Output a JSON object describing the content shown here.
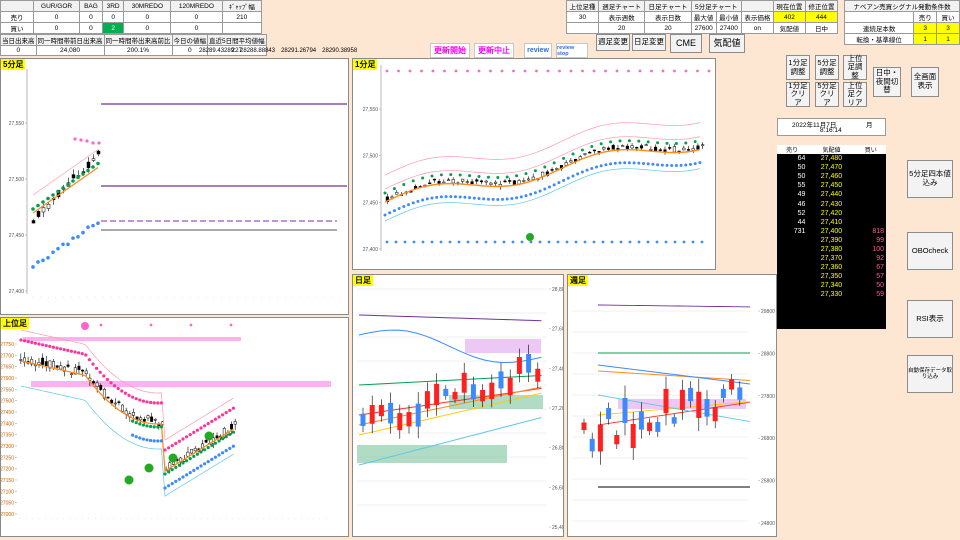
{
  "summary_table": {
    "headers": [
      "",
      "GUR/GOR",
      "BAG",
      "3RD",
      "30MREDO",
      "120MREDO",
      "ｷﾞｬｯﾌﾟ幅"
    ],
    "rows": [
      [
        "売り",
        "0",
        "0",
        "0",
        "0",
        "0",
        "210"
      ],
      [
        "買い",
        "0",
        "0",
        "2",
        "0",
        "0",
        ""
      ]
    ]
  },
  "stats": {
    "labels": [
      "当日出来高",
      "同一時間帯前日出来高",
      "同一時間帯出来高前比",
      "今日の値幅",
      "直近5日間平均値幅"
    ],
    "values": [
      "0",
      "24,080",
      "200.1%",
      "0",
      "227"
    ],
    "numbers": [
      "28289.43289",
      "28288.88843",
      "28291.26794",
      "28290.38958"
    ]
  },
  "toolbar": {
    "update_start": "更新開始",
    "update_stop": "更新中止",
    "review": "review",
    "review_stop": "review stop"
  },
  "chart_settings": {
    "headers": [
      "上位足種",
      "週足チャート",
      "日足チャート",
      "5分足チャート",
      "",
      "",
      "現在位置",
      "修正位置"
    ],
    "row2": [
      "30",
      "表示週数",
      "表示日数",
      "最大値",
      "最小値",
      "表示価格",
      "402",
      "444"
    ],
    "row3": [
      "",
      "20",
      "20",
      "27600",
      "27400",
      "on",
      "気配値",
      "日中"
    ],
    "btn_week": "週足変更",
    "btn_day": "日足変更",
    "btn_cme": "CME",
    "btn_quote": "気配値"
  },
  "signal_panel": {
    "title": "ナベアン売買シグナル発動条件数",
    "sell_label": "売り",
    "buy_label": "買い",
    "row1_label": "連続足本数",
    "row1_values": [
      "3",
      "3"
    ],
    "row2_label": "転換・基準線位",
    "row2_values": [
      "1",
      "1"
    ]
  },
  "right_buttons": {
    "b1m_adjust": "1分足調整",
    "b5m_adjust": "5分足調整",
    "bup_adjust": "上位足調整",
    "b1m_clear": "1分足クリア",
    "b5m_clear": "5分足クリア",
    "bup_clear": "上位足クリア",
    "session_switch": "日中・夜間切替",
    "full_screen": "全画面表示",
    "load_5m": "5分足四本値込み",
    "obo_check": "OBOcheck",
    "rsi_show": "RSI表示",
    "auto_save": "自動保存データ取り込み"
  },
  "datetime": {
    "date": "2022年11月7日",
    "weekday": "月",
    "time": "8:16:14"
  },
  "board": {
    "headers": [
      "売り",
      "気配値",
      "買い"
    ],
    "rows": [
      [
        "64",
        "27,480",
        ""
      ],
      [
        "50",
        "27,470",
        ""
      ],
      [
        "50",
        "27,460",
        ""
      ],
      [
        "55",
        "27,450",
        ""
      ],
      [
        "49",
        "27,440",
        ""
      ],
      [
        "46",
        "27,430",
        ""
      ],
      [
        "52",
        "27,420",
        ""
      ],
      [
        "44",
        "27,410",
        ""
      ],
      [
        "731",
        "27,400",
        "818"
      ],
      [
        "",
        "27,390",
        "99"
      ],
      [
        "",
        "27,380",
        "100"
      ],
      [
        "",
        "27,370",
        "92"
      ],
      [
        "",
        "27,360",
        "67"
      ],
      [
        "",
        "27,350",
        "57"
      ],
      [
        "",
        "27,340",
        "50"
      ],
      [
        "",
        "27,330",
        "59"
      ]
    ]
  },
  "panels": {
    "p5m": {
      "title": "5分足",
      "yticks": [
        "27,550",
        "27,500",
        "27,450",
        "27,400"
      ]
    },
    "p1m": {
      "title": "1分足",
      "yticks": [
        "27,550",
        "27,500",
        "27,450",
        "27,400"
      ]
    },
    "pup": {
      "title": "上位足",
      "yticks": [
        "27750",
        "27700",
        "27650",
        "27600",
        "27550",
        "27500",
        "27450",
        "27400",
        "27350",
        "27300",
        "27250",
        "27200",
        "27150",
        "27100",
        "27050",
        "27000"
      ]
    },
    "pday": {
      "title": "日足",
      "yticks": [
        "28,800",
        "27,600",
        "27,400",
        "27,200",
        "26,800",
        "26,600",
        "25,400"
      ]
    },
    "pweek": {
      "title": "週足",
      "yticks": [
        "29800",
        "28800",
        "27800",
        "26800",
        "25800",
        "24800"
      ]
    }
  },
  "colors": {
    "background": "#fde7d2",
    "accent_magenta": "#ff00ff",
    "panel_title": "#ffff00"
  }
}
